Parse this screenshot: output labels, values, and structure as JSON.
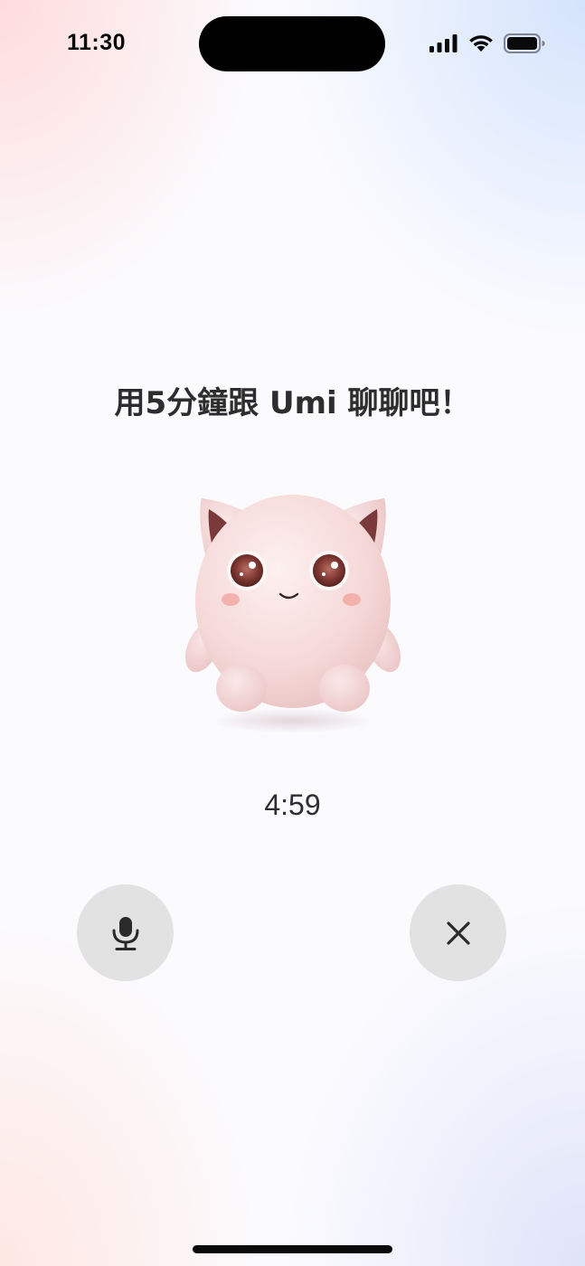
{
  "status_bar": {
    "time": "11:30",
    "icons": [
      "cellular-signal-icon",
      "wifi-icon",
      "battery-icon"
    ]
  },
  "prompt": {
    "heading": "用5分鐘跟 Umi 聊聊吧！"
  },
  "mascot": {
    "icon": "umi-mascot-icon",
    "colors": {
      "body": "#f6dcdc",
      "ear_inner": "#7a3a3a",
      "eye": "#7b3530",
      "cheek": "#f2a9a3"
    }
  },
  "timer": {
    "remaining": "4:59"
  },
  "controls": {
    "mic_icon": "microphone-icon",
    "close_icon": "close-icon",
    "button_color": "#e2e2e3",
    "icon_color": "#2a2a2a"
  }
}
